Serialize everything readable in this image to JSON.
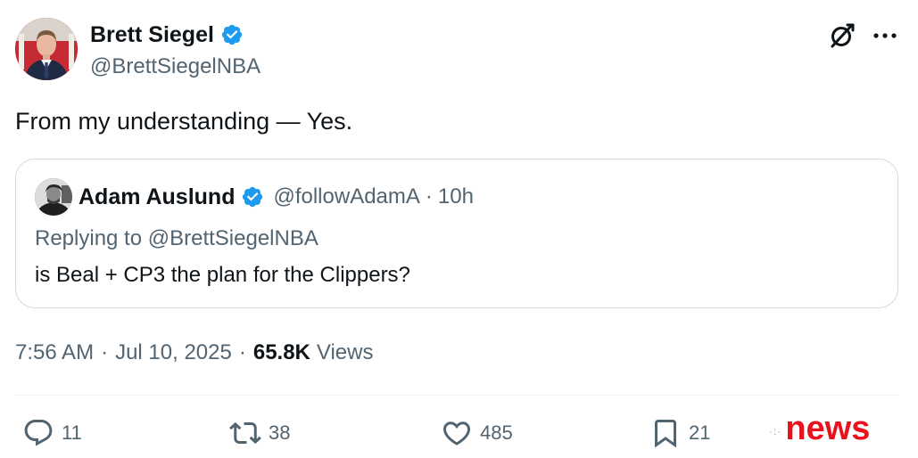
{
  "author": {
    "name": "Brett Siegel",
    "handle": "@BrettSiegelNBA",
    "verified": true
  },
  "tweet": {
    "text": "From my understanding — Yes."
  },
  "quoted_tweet": {
    "author_name": "Adam Auslund",
    "handle": "@followAdamA",
    "separator": "·",
    "time": "10h",
    "replying_to": "Replying to @BrettSiegelNBA",
    "text": "is Beal + CP3 the plan for the Clippers?"
  },
  "meta": {
    "time": "7:56 AM",
    "sep1": "·",
    "date": "Jul 10, 2025",
    "sep2": "·",
    "views_count": "65.8K",
    "views_label": "Views"
  },
  "actions": {
    "replies": "11",
    "reposts": "38",
    "likes": "485",
    "bookmarks": "21"
  },
  "watermark": {
    "text": "news"
  },
  "colors": {
    "text_primary": "#0f1419",
    "text_secondary": "#536471",
    "verified_blue": "#1d9bf0",
    "border": "#cfd9de",
    "watermark_red": "#e8121d"
  },
  "icons": {
    "verified": "verified-badge-icon",
    "grok": "grok-icon",
    "more": "more-dots-icon",
    "reply": "reply-icon",
    "repost": "repost-icon",
    "like": "heart-icon",
    "bookmark": "bookmark-icon"
  }
}
